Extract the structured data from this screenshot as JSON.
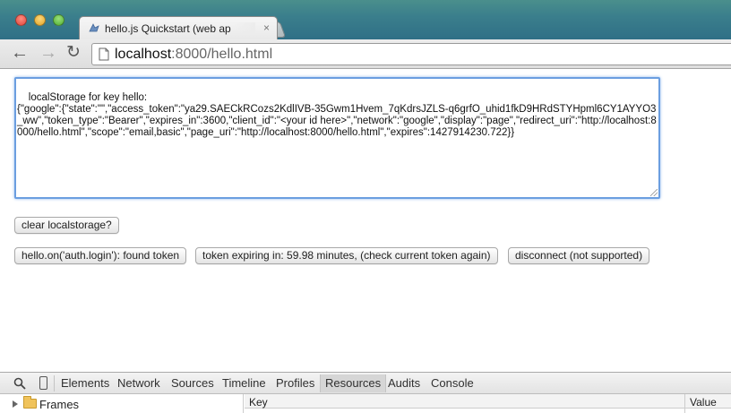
{
  "window": {
    "tab_title": "hello.js Quickstart (web ap",
    "tab_close": "×"
  },
  "toolbar": {
    "back_glyph": "←",
    "forward_glyph": "→",
    "reload_glyph": "↻",
    "url_host": "localhost",
    "url_rest": ":8000/hello.html"
  },
  "page": {
    "textarea_value": "localStorage for key hello:\n{\"google\":{\"state\":\"\",\"access_token\":\"ya29.SAECkRCozs2KdlIVB-35Gwm1Hvem_7qKdrsJZLS-q6grfO_uhid1fkD9HRdSTYHpml6CY1AYYO3_ww\",\"token_type\":\"Bearer\",\"expires_in\":3600,\"client_id\":\"<your id here>\",\"network\":\"google\",\"display\":\"page\",\"redirect_uri\":\"http://localhost:8000/hello.html\",\"scope\":\"email,basic\",\"page_uri\":\"http://localhost:8000/hello.html\",\"expires\":1427914230.722}}",
    "clear_button": "clear localstorage?",
    "login_button": "hello.on('auth.login'): found token",
    "token_button": "token expiring in: 59.98 minutes, (check current token again)",
    "disconnect_button": "disconnect (not supported)"
  },
  "devtools": {
    "tabs": [
      "Elements",
      "Network",
      "Sources",
      "Timeline",
      "Profiles",
      "Resources",
      "Audits",
      "Console"
    ],
    "active_tab": "Resources",
    "tree_item": "Frames",
    "col_key": "Key",
    "col_value": "Value"
  },
  "colors": {
    "focus_ring": "#6b9ee0",
    "titlebar": "#3b7f8c"
  }
}
